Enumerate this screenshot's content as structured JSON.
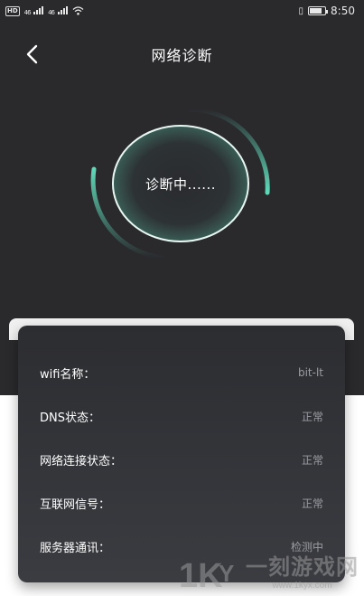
{
  "status_bar": {
    "hd": "HD",
    "signal_left": "46",
    "signal_right": "46",
    "time": "8:50"
  },
  "nav": {
    "title": "网络诊断"
  },
  "gauge": {
    "status_text": "诊断中......",
    "accent_color": "#5fd9b8"
  },
  "info": {
    "rows": [
      {
        "label": "wifi名称：",
        "value": "bit-lt"
      },
      {
        "label": "DNS状态：",
        "value": "正常"
      },
      {
        "label": "网络连接状态：",
        "value": "正常"
      },
      {
        "label": "互联网信号：",
        "value": "正常"
      },
      {
        "label": "服务器通讯：",
        "value": "检测中"
      }
    ]
  },
  "watermark": {
    "text": "一刻游戏网",
    "url": "www.1kyx.com"
  }
}
